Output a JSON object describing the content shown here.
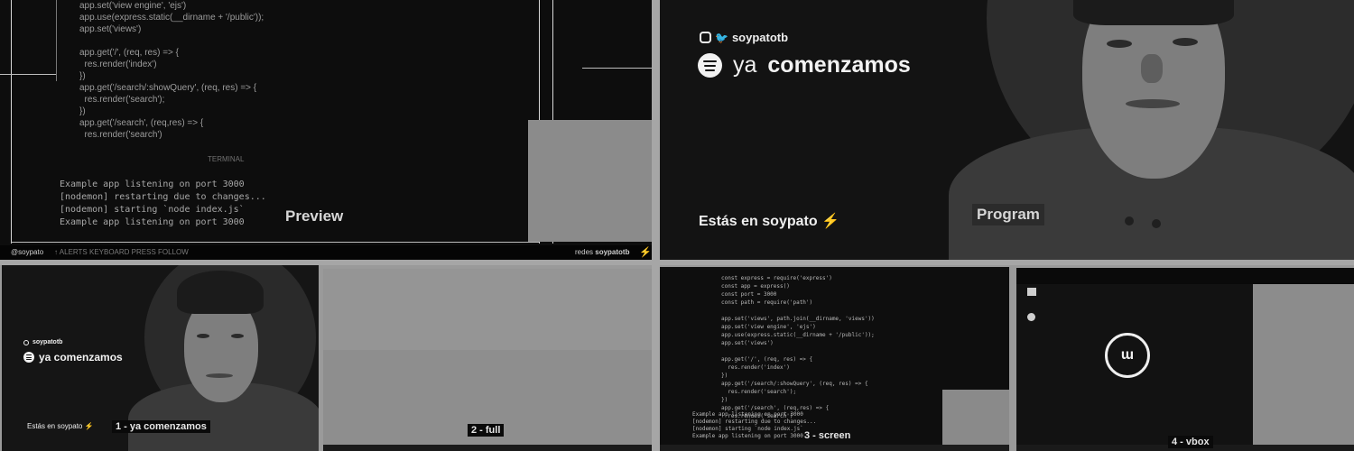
{
  "preview": {
    "label": "Preview",
    "code_lines": [
      "app.set('view engine', 'ejs')",
      "app.use(express.static(__dirname + '/public'));",
      "app.set('views')",
      "",
      "app.get('/', (req, res) => {",
      "  res.render('index')",
      "})",
      "app.get('/search/:showQuery', (req, res) => {",
      "  res.render('search');",
      "})",
      "app.get('/search', (req,res) => {",
      "  res.render('search')"
    ],
    "terminal_tab": "TERMINAL",
    "terminal_lines": [
      "Example app listening on port 3000",
      "[nodemon] restarting due to changes...",
      "[nodemon] starting `node index.js`",
      "Example app listening on port 3000"
    ],
    "bottom_bar": {
      "left": "@soypato",
      "middle": "↑ ALERTS  KEYBOARD  PRESS FOLLOW",
      "right_prefix": "redes",
      "right_handle": "soypatotb"
    }
  },
  "program": {
    "label": "Program",
    "handle": "soypatotb",
    "title_light": "ya",
    "title_bold": "comenzamos",
    "estas_prefix": "Estás en",
    "estas_bold": "soypato",
    "bolt": "⚡"
  },
  "scenes": [
    {
      "label": "1 - ya comenzamos",
      "handle": "soypatotb",
      "title": "ya comenzamos",
      "estas": "Estás en soypato ⚡"
    },
    {
      "label": "2 - full"
    },
    {
      "label": "3 - screen",
      "code_lines": [
        "const express = require('express')",
        "const app = express()",
        "const port = 3000",
        "const path = require('path')",
        "",
        "app.set('views', path.join(__dirname, 'views'))",
        "app.set('view engine', 'ejs')",
        "app.use(express.static(__dirname + '/public'));",
        "app.set('views')",
        "",
        "app.get('/', (req, res) => {",
        "  res.render('index')",
        "})",
        "app.get('/search/:showQuery', (req, res) => {",
        "  res.render('search');",
        "})",
        "app.get('/search', (req,res) => {",
        "  res.render('search')"
      ],
      "terminal_lines": [
        "Example app listening on port 3000",
        "[nodemon] restarting due to changes...",
        "[nodemon] starting `node index.js`",
        "Example app listening on port 3000"
      ]
    },
    {
      "label": "4 - vbox"
    }
  ]
}
